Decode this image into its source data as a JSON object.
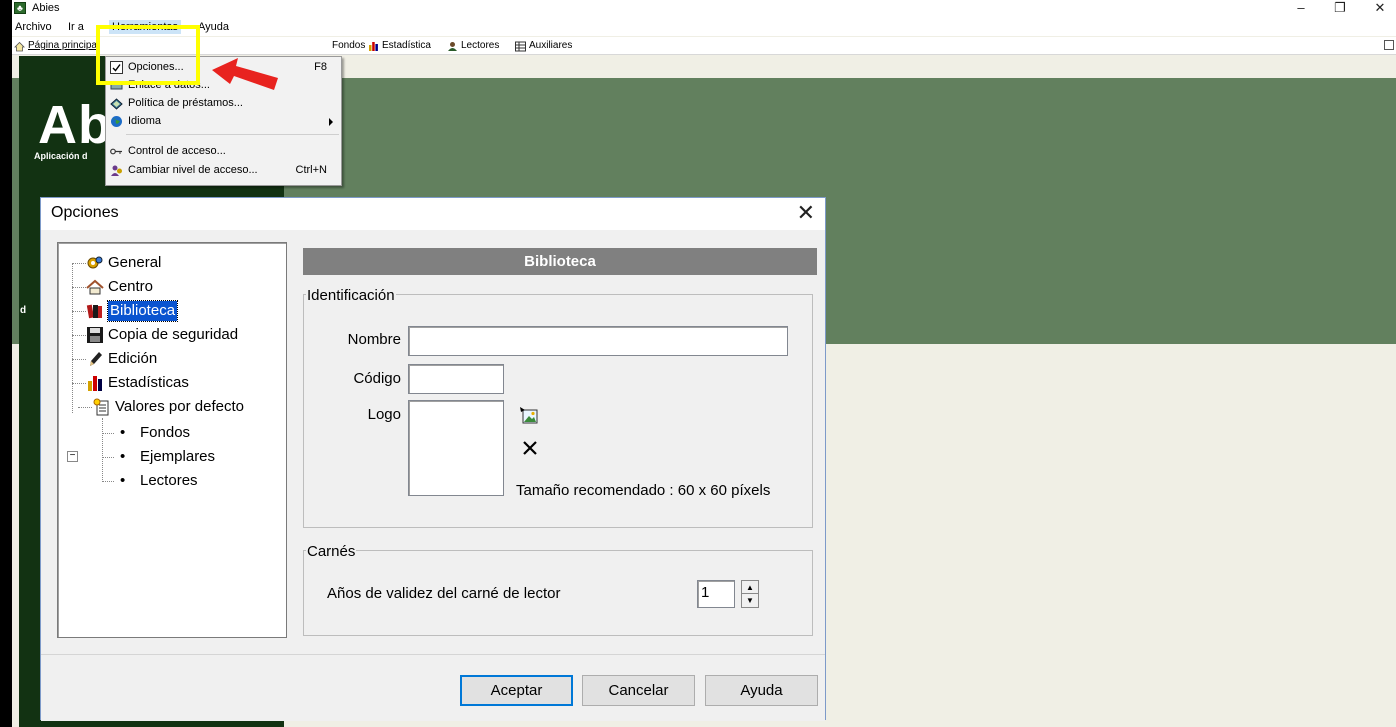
{
  "window": {
    "title": "Abies",
    "controls": {
      "minimize": "–",
      "restore": "❐",
      "close": "✕"
    }
  },
  "menubar": {
    "items": [
      "Archivo",
      "Ir a",
      "Herramientas",
      "Ayuda"
    ]
  },
  "toolbar": {
    "items": [
      "Página principal",
      "Fondos",
      "Estadística",
      "Lectores",
      "Auxiliares"
    ]
  },
  "background": {
    "logo_text": "Abi",
    "logo_subtitle": "Aplicación d",
    "side_letter": "d"
  },
  "dropdown": {
    "items": [
      {
        "label": "Opciones...",
        "shortcut": "F8",
        "icon": "options-icon"
      },
      {
        "label": "Enlace a datos...",
        "shortcut": "",
        "icon": "data-link-icon"
      },
      {
        "label": "Política de préstamos...",
        "shortcut": "",
        "icon": "loan-policy-icon"
      },
      {
        "label": "Idioma",
        "shortcut": "",
        "icon": "globe-icon",
        "submenu": true
      },
      {
        "label": "Control de acceso...",
        "shortcut": "",
        "icon": "key-icon"
      },
      {
        "label": "Cambiar nivel de acceso...",
        "shortcut": "Ctrl+N",
        "icon": "access-level-icon"
      }
    ]
  },
  "dialog": {
    "title": "Opciones",
    "close": "✕",
    "tree": {
      "items": [
        {
          "label": "General",
          "icon": "gears-icon"
        },
        {
          "label": "Centro",
          "icon": "house-icon"
        },
        {
          "label": "Biblioteca",
          "icon": "books-icon",
          "selected": true
        },
        {
          "label": "Copia de seguridad",
          "icon": "floppy-icon"
        },
        {
          "label": "Edición",
          "icon": "pencil-icon"
        },
        {
          "label": "Estadísticas",
          "icon": "bar-chart-icon"
        },
        {
          "label": "Valores por defecto",
          "icon": "document-icon",
          "expanded": true
        }
      ],
      "children": [
        "Fondos",
        "Ejemplares",
        "Lectores"
      ],
      "expander": "−"
    },
    "panel": {
      "header": "Biblioteca",
      "identificacion": {
        "legend": "Identificación",
        "nombre_label": "Nombre",
        "nombre_value": "",
        "codigo_label": "Código",
        "codigo_value": "",
        "logo_label": "Logo",
        "recommended_size": "Tamaño recomendado : 60 x 60 píxels"
      },
      "carnes": {
        "legend": "Carnés",
        "years_label": "Años de validez del carné de lector",
        "years_value": "1"
      }
    },
    "buttons": {
      "accept": "Aceptar",
      "cancel": "Cancelar",
      "help": "Ayuda"
    }
  },
  "colors": {
    "highlight": "#ffff00",
    "annotation_arrow": "#e8231f",
    "green_area": "#62805e",
    "dark_panel": "#123212",
    "selection": "#0a54d0"
  }
}
